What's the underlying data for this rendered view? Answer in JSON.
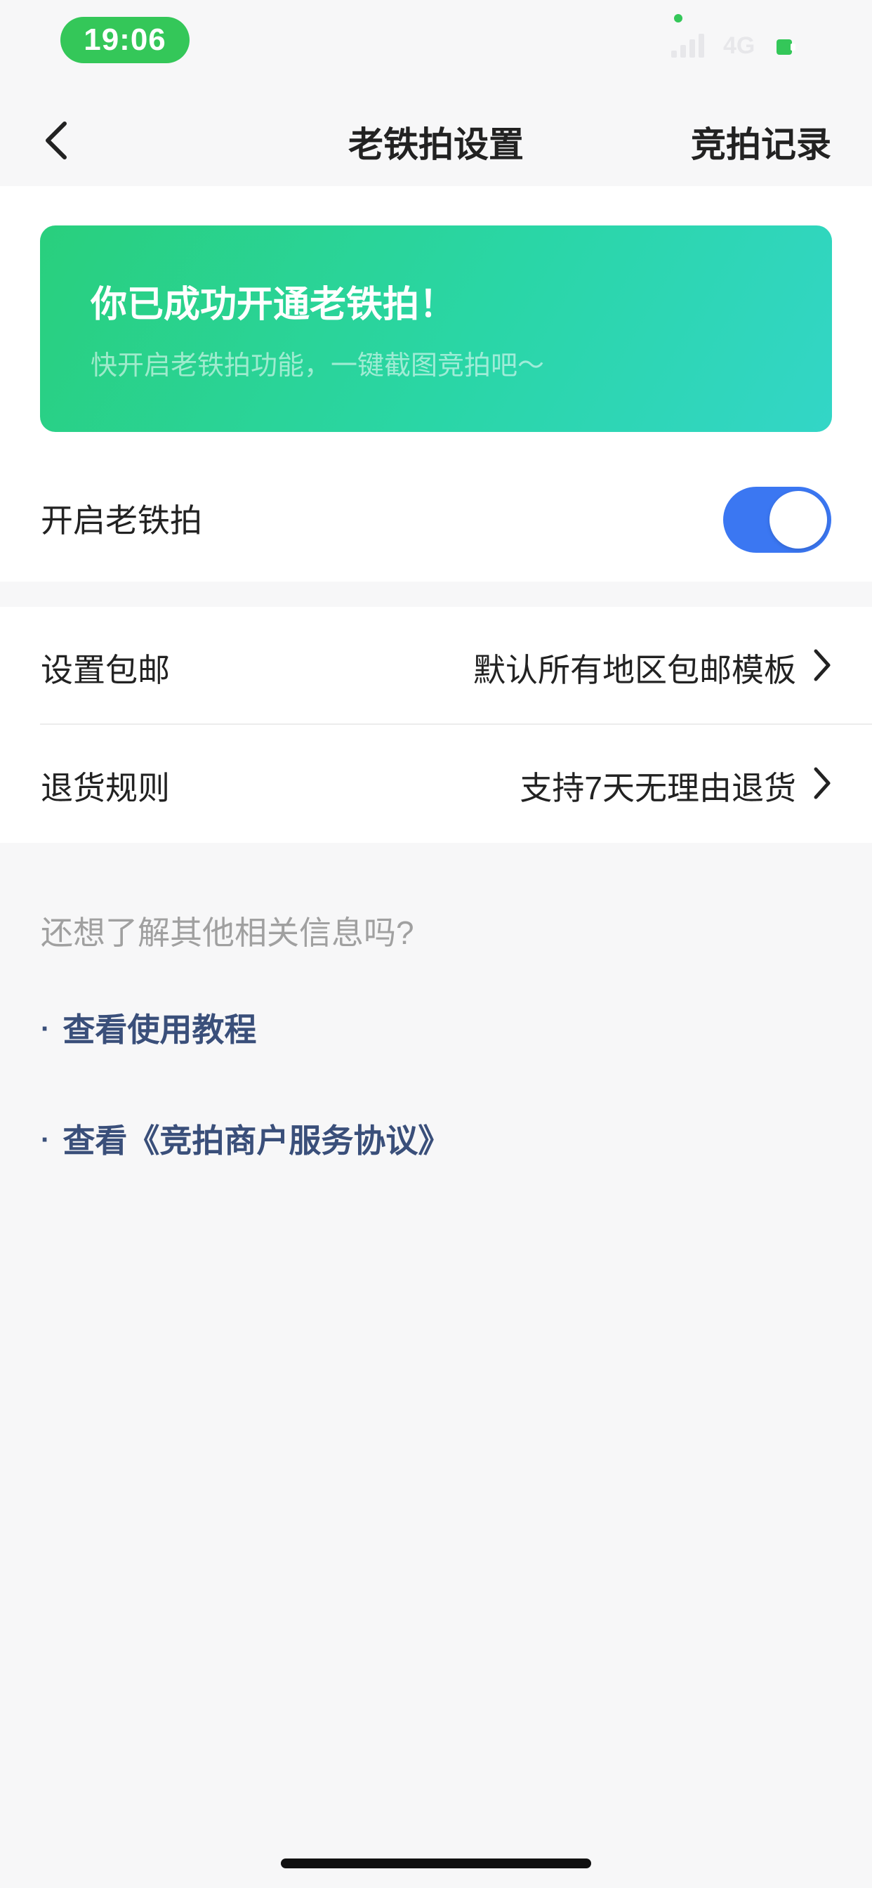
{
  "status_bar": {
    "time": "19:06",
    "network": "4G"
  },
  "nav": {
    "title": "老铁拍设置",
    "right_action": "竞拍记录"
  },
  "banner": {
    "title": "你已成功开通老铁拍！",
    "subtitle": "快开启老铁拍功能，一键截图竞拍吧～"
  },
  "toggle_row": {
    "label": "开启老铁拍",
    "enabled": true
  },
  "settings": [
    {
      "label": "设置包邮",
      "value": "默认所有地区包邮模板"
    },
    {
      "label": "退货规则",
      "value": "支持7天无理由退货"
    }
  ],
  "info": {
    "question": "还想了解其他相关信息吗?",
    "bullet": "·",
    "links": [
      "查看使用教程",
      "查看《竞拍商户服务协议》"
    ]
  },
  "colors": {
    "status_green": "#34c759",
    "toggle_blue": "#3b77f2",
    "link_blue": "#3a4f7a",
    "banner_start": "#29cf7d",
    "banner_end": "#33d6c7"
  },
  "icons": {
    "back": "chevron-left-icon",
    "row_arrow": "chevron-right-icon"
  }
}
